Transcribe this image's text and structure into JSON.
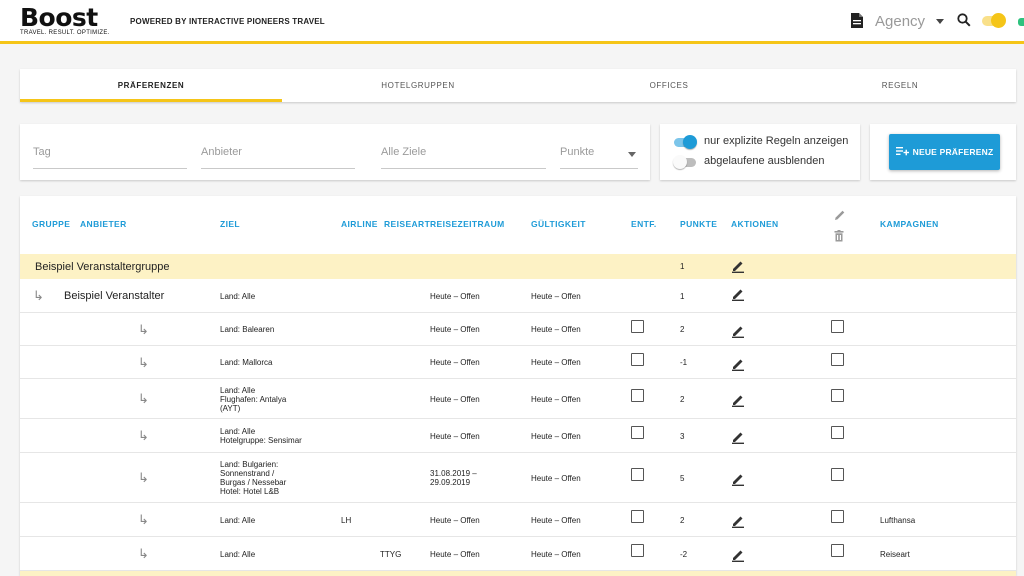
{
  "header": {
    "logo": "Boost",
    "tagline": "TRAVEL. RESULT. OPTIMIZE.",
    "powered_by": "POWERED BY INTERACTIVE PIONEERS TRAVEL",
    "agency": "Agency"
  },
  "tabs": [
    {
      "label": "PRÄFERENZEN",
      "active": true
    },
    {
      "label": "HOTELGRUPPEN",
      "active": false
    },
    {
      "label": "OFFICES",
      "active": false
    },
    {
      "label": "REGELN",
      "active": false
    }
  ],
  "filters": {
    "tag": "Tag",
    "anbieter": "Anbieter",
    "ziele": "Alle Ziele",
    "punkte": "Punkte"
  },
  "toggles": {
    "explicit": {
      "label": "nur explizite Regeln anzeigen",
      "on": true
    },
    "expired": {
      "label": "abgelaufene ausblenden",
      "on": false
    }
  },
  "add_button": "NEUE PRÄFERENZ",
  "table": {
    "headers": {
      "gruppe": "GRUPPE",
      "anbieter": "ANBIETER",
      "ziel": "ZIEL",
      "airline": "AIRLINE",
      "reiseart": "REISEART",
      "reisezeitraum": "REISEZEITRAUM",
      "gueltigkeit": "GÜLTIGKEIT",
      "entf": "ENTF.",
      "punkte": "PUNKTE",
      "aktionen": "AKTIONEN",
      "kampagnen": "KAMPAGNEN"
    },
    "group_row": {
      "name": "Beispiel Veranstaltergruppe",
      "punkte": "1"
    },
    "provider_row": {
      "arrow": "↳",
      "name": "Beispiel Veranstalter",
      "ziel": "Land: Alle",
      "zeitraum": "Heute – Offen",
      "gueltigkeit": "Heute – Offen",
      "punkte": "1"
    },
    "rows": [
      {
        "arrow": "↳",
        "ziel": "Land: Balearen",
        "airline": "",
        "reiseart": "",
        "zeitraum": "Heute – Offen",
        "gueltigkeit": "Heute – Offen",
        "punkte": "2",
        "kampagne": ""
      },
      {
        "arrow": "↳",
        "ziel": "Land: Mallorca",
        "airline": "",
        "reiseart": "",
        "zeitraum": "Heute – Offen",
        "gueltigkeit": "Heute – Offen",
        "punkte": "-1",
        "kampagne": ""
      },
      {
        "arrow": "↳",
        "ziel": "Land: Alle\nFlughafen: Antalya\n(AYT)",
        "airline": "",
        "reiseart": "",
        "zeitraum": "Heute – Offen",
        "gueltigkeit": "Heute – Offen",
        "punkte": "2",
        "kampagne": ""
      },
      {
        "arrow": "↳",
        "ziel": "Land: Alle\nHotelgruppe: Sensimar",
        "airline": "",
        "reiseart": "",
        "zeitraum": "Heute – Offen",
        "gueltigkeit": "Heute – Offen",
        "punkte": "3",
        "kampagne": ""
      },
      {
        "arrow": "↳",
        "ziel": "Land: Bulgarien:\nSonnenstrand /\nBurgas / Nessebar\nHotel: Hotel L&B",
        "airline": "",
        "reiseart": "",
        "zeitraum": "31.08.2019 –\n29.09.2019",
        "gueltigkeit": "Heute – Offen",
        "punkte": "5",
        "kampagne": ""
      },
      {
        "arrow": "↳",
        "ziel": "Land: Alle",
        "airline": "LH",
        "reiseart": "",
        "zeitraum": "Heute – Offen",
        "gueltigkeit": "Heute – Offen",
        "punkte": "2",
        "kampagne": "Lufthansa"
      },
      {
        "arrow": "↳",
        "ziel": "Land: Alle",
        "airline": "",
        "reiseart": "TTYG",
        "zeitraum": "Heute – Offen",
        "gueltigkeit": "Heute – Offen",
        "punkte": "-2",
        "kampagne": "Reiseart"
      }
    ]
  },
  "colors": {
    "accent": "#f5c518",
    "primary": "#1e9bd7",
    "group_bg": "#fdf2c5"
  }
}
